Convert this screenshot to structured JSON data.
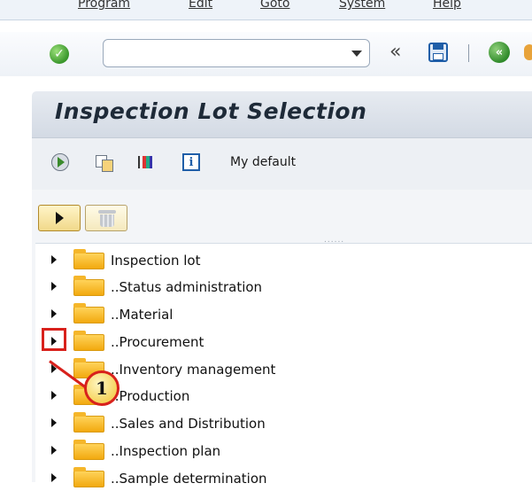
{
  "menubar": {
    "items": [
      "Program",
      "Edit",
      "Goto",
      "System",
      "Help"
    ]
  },
  "toolbar": {
    "command_value": "",
    "collapse_glyph": "«",
    "back_glyph": "«"
  },
  "screen": {
    "title": "Inspection Lot Selection"
  },
  "app_toolbar": {
    "variant_label": "My default",
    "info_glyph": "i"
  },
  "tree": {
    "splitter": "......",
    "items": [
      "Inspection lot",
      "..Status administration",
      "..Material",
      "..Procurement",
      "..Inventory management",
      "..Production",
      "..Sales and Distribution",
      "..Inspection plan",
      "..Sample determination"
    ]
  },
  "callout": {
    "number": "1",
    "color": "#d8211c"
  },
  "colors": {
    "folder": "#f2a90f",
    "title_bg": "#d3dae4",
    "accent_blue": "#1f5ea8"
  }
}
